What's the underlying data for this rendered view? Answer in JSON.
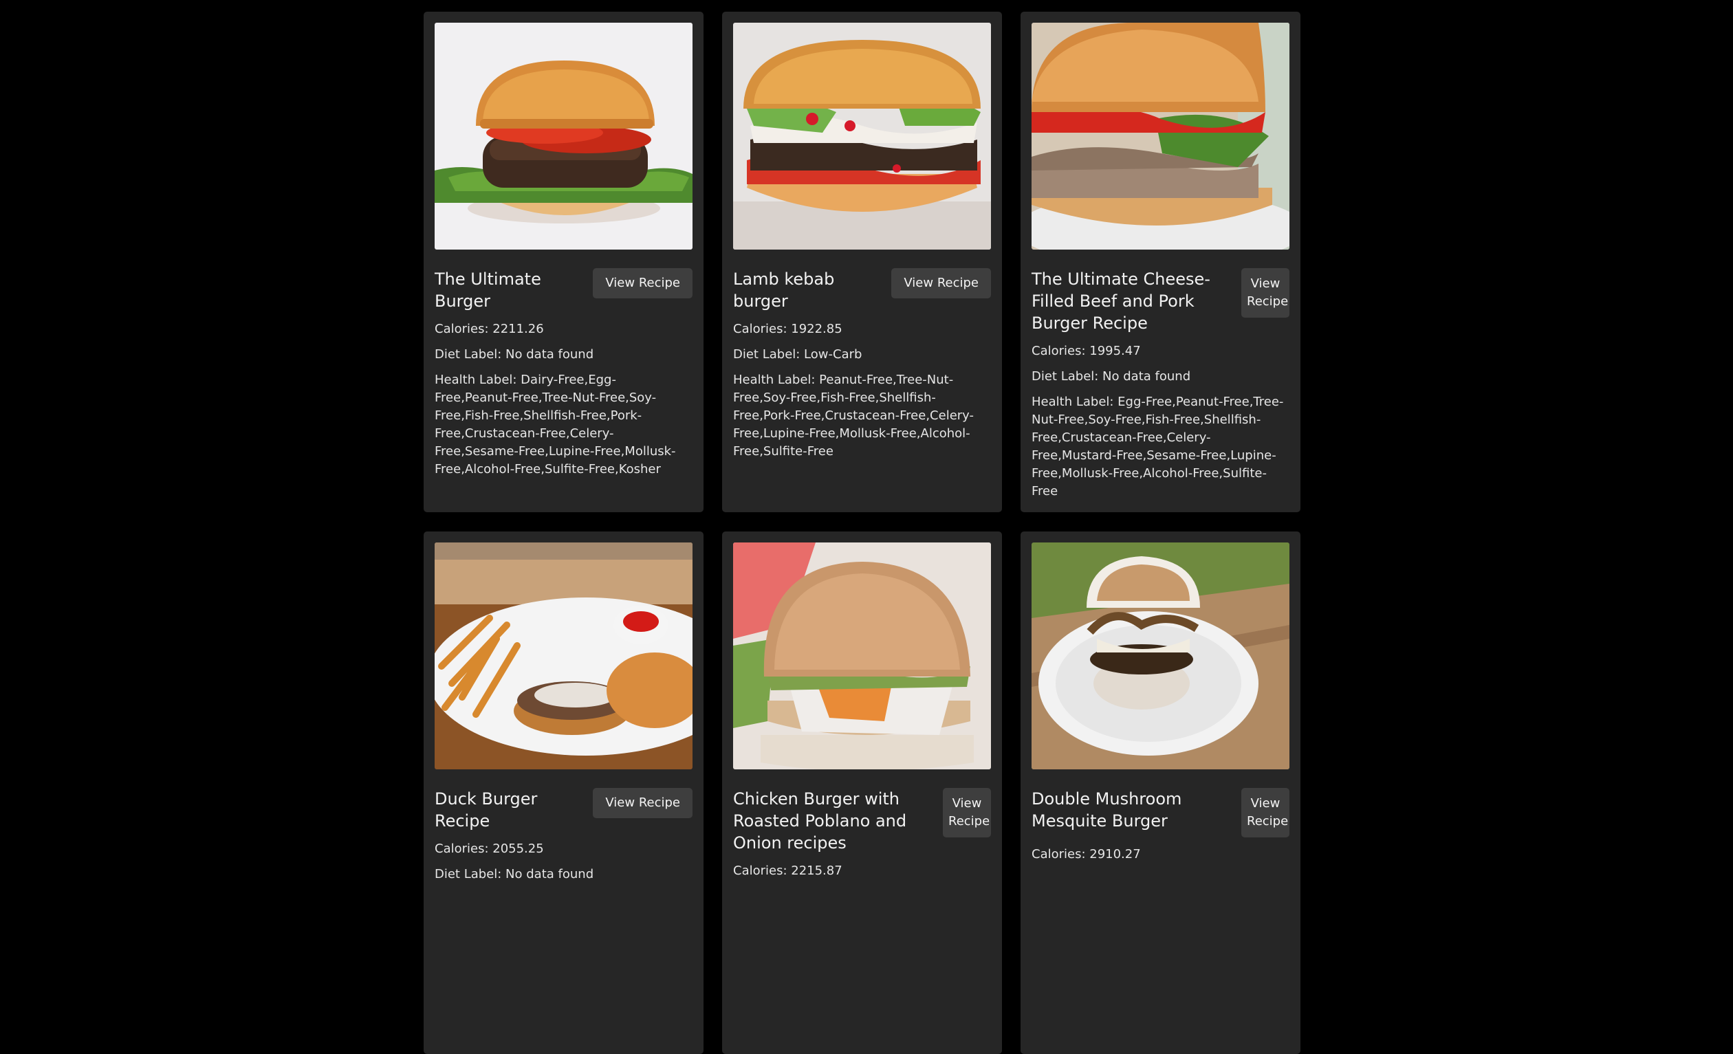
{
  "recipes": [
    {
      "title": "The Ultimate Burger",
      "button": "View Recipe",
      "calories": "Calories: 2211.26",
      "diet": "Diet Label: No data found",
      "health": "Health Label: Dairy-Free,Egg-Free,Peanut-Free,Tree-Nut-Free,Soy-Free,Fish-Free,Shellfish-Free,Pork-Free,Crustacean-Free,Celery-Free,Sesame-Free,Lupine-Free,Mollusk-Free,Alcohol-Free,Sulfite-Free,Kosher"
    },
    {
      "title": "Lamb kebab burger",
      "button": "View Recipe",
      "calories": "Calories: 1922.85",
      "diet": "Diet Label: Low-Carb",
      "health": "Health Label: Peanut-Free,Tree-Nut-Free,Soy-Free,Fish-Free,Shellfish-Free,Pork-Free,Crustacean-Free,Celery-Free,Lupine-Free,Mollusk-Free,Alcohol-Free,Sulfite-Free"
    },
    {
      "title": "The Ultimate Cheese-Filled Beef and Pork Burger Recipe",
      "button": "View Recipe",
      "calories": "Calories: 1995.47",
      "diet": "Diet Label: No data found",
      "health": "Health Label: Egg-Free,Peanut-Free,Tree-Nut-Free,Soy-Free,Fish-Free,Shellfish-Free,Crustacean-Free,Celery-Free,Mustard-Free,Sesame-Free,Lupine-Free,Mollusk-Free,Alcohol-Free,Sulfite-Free"
    },
    {
      "title": "Duck Burger Recipe",
      "button": "View Recipe",
      "calories": "Calories: 2055.25",
      "diet": "Diet Label: No data found",
      "health": ""
    },
    {
      "title": "Chicken Burger with Roasted Poblano and Onion recipes",
      "button": "View Recipe",
      "calories": "Calories: 2215.87",
      "diet": "",
      "health": ""
    },
    {
      "title": "Double Mushroom Mesquite Burger",
      "button": "View Recipe",
      "calories": "Calories: 2910.27",
      "diet": "",
      "health": ""
    }
  ]
}
